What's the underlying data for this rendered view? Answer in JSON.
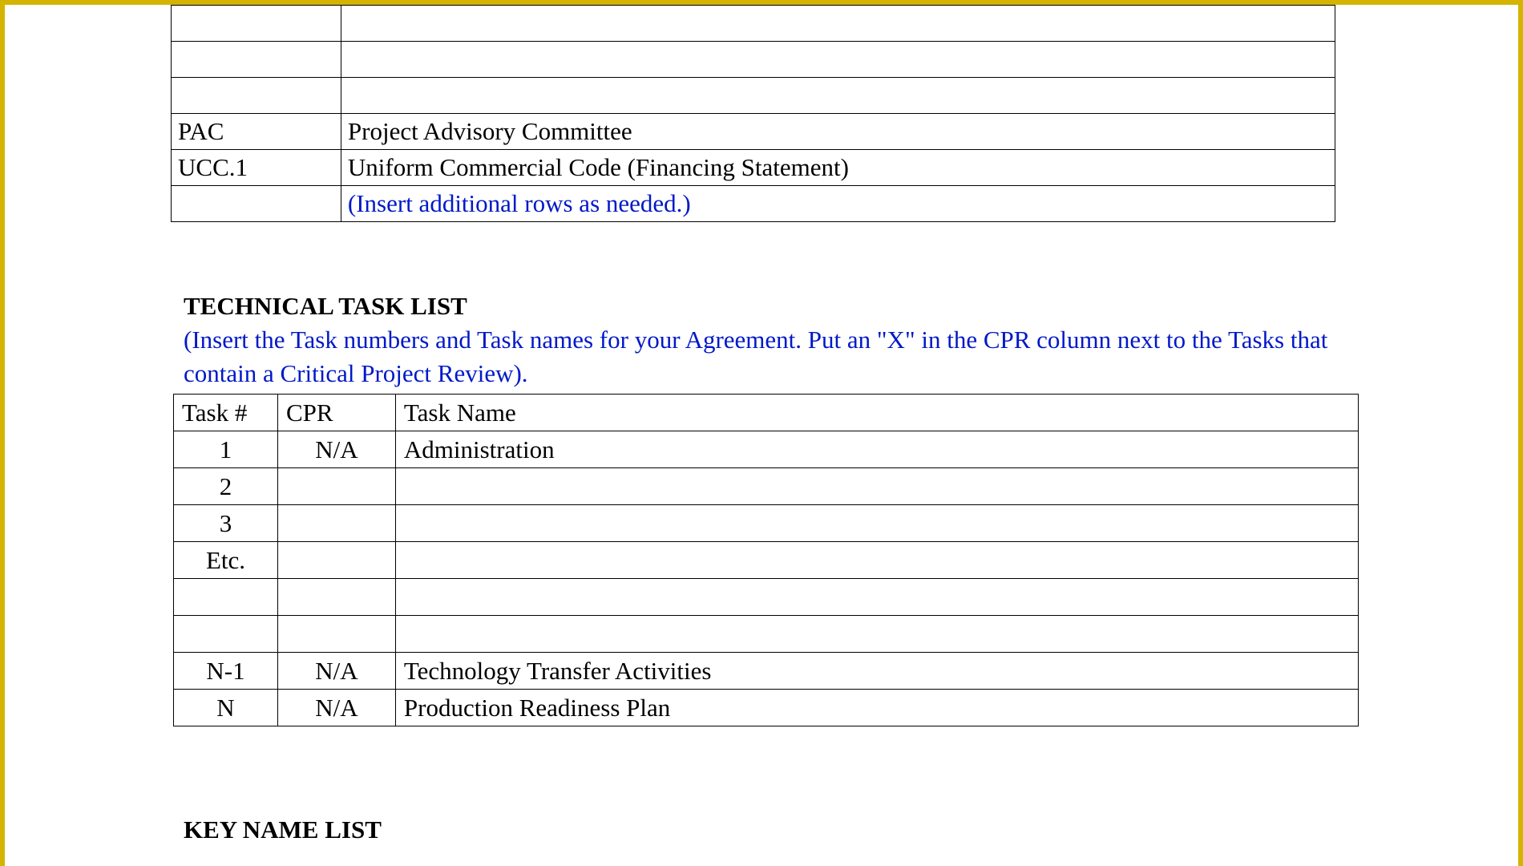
{
  "definitions": {
    "rows": [
      {
        "abbr": "",
        "def": ""
      },
      {
        "abbr": "",
        "def": ""
      },
      {
        "abbr": "",
        "def": ""
      },
      {
        "abbr": "PAC",
        "def": "Project Advisory Committee"
      },
      {
        "abbr": "UCC.1",
        "def": "Uniform Commercial Code (Financing Statement)"
      },
      {
        "abbr": "",
        "def": "(Insert additional rows as needed.)",
        "instr": true
      }
    ]
  },
  "technical_task_list": {
    "title": "TECHNICAL TASK LIST",
    "instruction": "(Insert the Task numbers and Task names for your Agreement.  Put an \"X\" in the CPR column next to the Tasks that contain a Critical Project Review).",
    "headers": {
      "task_num": "Task #",
      "cpr": "CPR",
      "task_name": "Task Name"
    },
    "rows": [
      {
        "num": "1",
        "cpr": "N/A",
        "name": "Administration"
      },
      {
        "num": "2",
        "cpr": "",
        "name": ""
      },
      {
        "num": "3",
        "cpr": "",
        "name": ""
      },
      {
        "num": "Etc.",
        "cpr": "",
        "name": ""
      },
      {
        "num": "",
        "cpr": "",
        "name": ""
      },
      {
        "num": "",
        "cpr": "",
        "name": ""
      },
      {
        "num": "N-1",
        "cpr": "N/A",
        "name": "Technology Transfer Activities"
      },
      {
        "num": "N",
        "cpr": "N/A",
        "name": "Production Readiness Plan"
      }
    ]
  },
  "key_name_list": {
    "title": "KEY NAME LIST"
  }
}
